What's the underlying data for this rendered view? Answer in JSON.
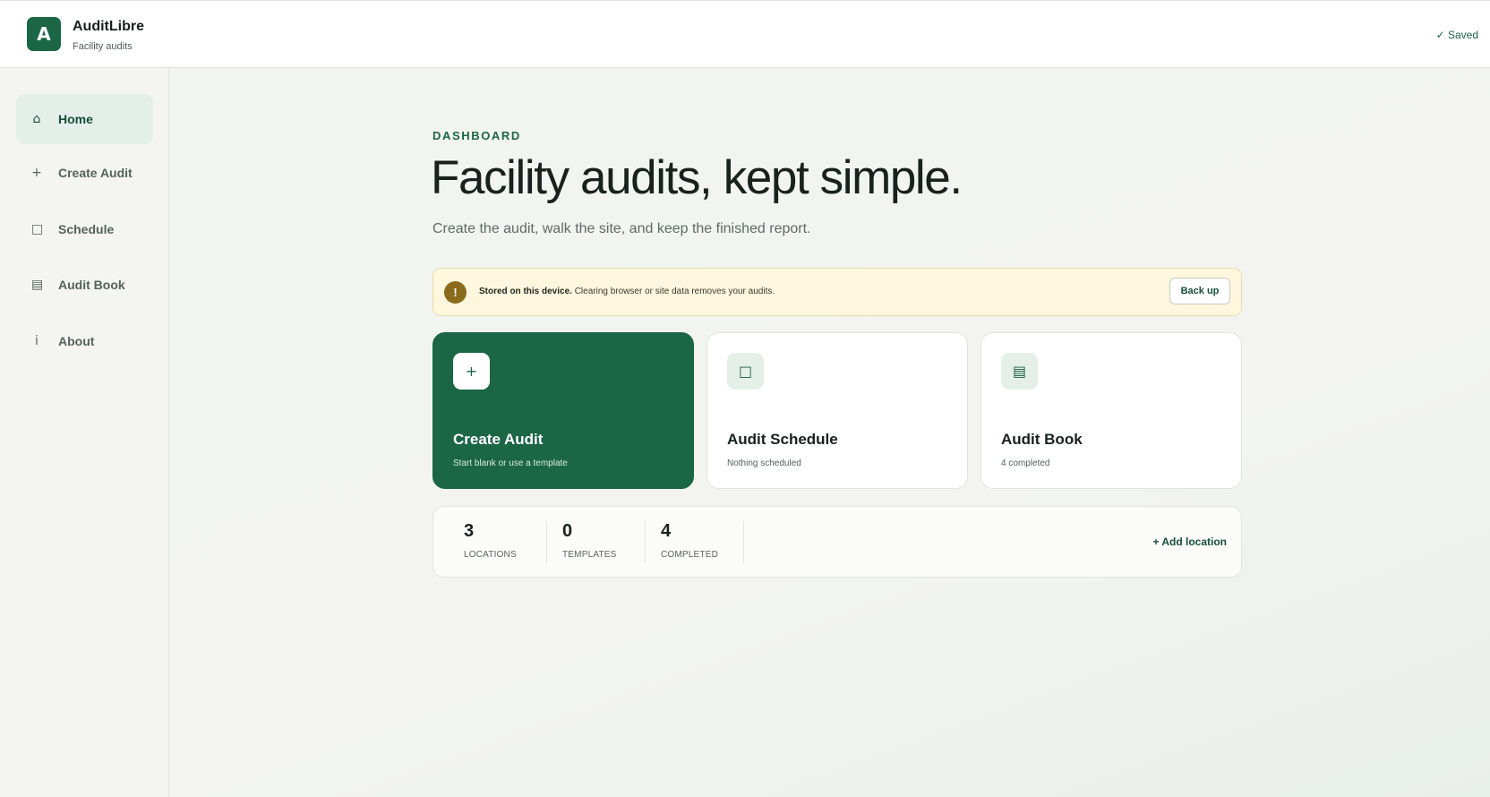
{
  "app": {
    "logo_letter": "A",
    "name": "AuditLibre",
    "subtitle": "Facility audits",
    "save_status": "✓ Saved"
  },
  "sidebar": {
    "items": [
      {
        "icon": "⌂",
        "icon_name": "home-icon",
        "label": "Home",
        "active": true
      },
      {
        "icon": "+",
        "icon_name": "plus-icon",
        "label": "Create Audit",
        "active": false
      },
      {
        "icon": "□",
        "icon_name": "calendar-icon",
        "label": "Schedule",
        "active": false
      },
      {
        "icon": "▤",
        "icon_name": "book-icon",
        "label": "Audit Book",
        "active": false
      },
      {
        "icon": "i",
        "icon_name": "info-icon",
        "label": "About",
        "active": false
      }
    ]
  },
  "main": {
    "eyebrow": "DASHBOARD",
    "headline": "Facility audits, kept simple.",
    "subline": "Create the audit, walk the site, and keep the finished report.",
    "notice": {
      "icon": "!",
      "strong": "Stored on this device.",
      "text": " Clearing browser or site data removes your audits.",
      "button": "Back up"
    },
    "cards": [
      {
        "icon": "+",
        "title": "Create Audit",
        "sub": "Start blank or use a template"
      },
      {
        "icon": "□",
        "title": "Audit Schedule",
        "sub": "Nothing scheduled"
      },
      {
        "icon": "▤",
        "title": "Audit Book",
        "sub": "4 completed"
      }
    ],
    "stats": [
      {
        "value": "3",
        "label": "LOCATIONS"
      },
      {
        "value": "0",
        "label": "TEMPLATES"
      },
      {
        "value": "4",
        "label": "COMPLETED"
      }
    ],
    "add_location": "+ Add location"
  },
  "colors": {
    "brand": "#1b6645",
    "nav_active_bg": "#e3efe8",
    "notice_bg": "#fef7de",
    "notice_icon": "#8a6a1c"
  }
}
